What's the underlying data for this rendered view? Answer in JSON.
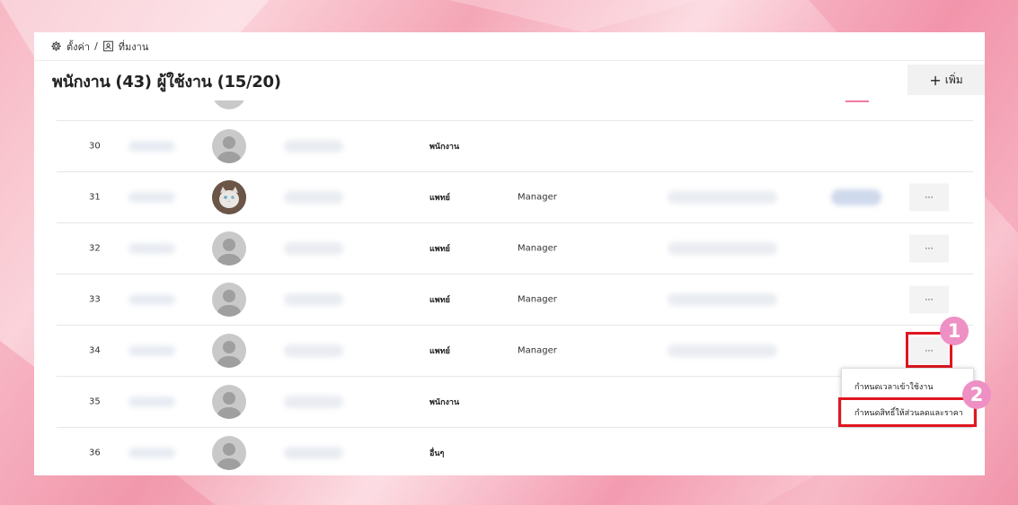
{
  "breadcrumb": {
    "settings_icon": "gear-icon",
    "settings_label": "ตั้งค่า",
    "separator": "/",
    "workspace_icon": "contact-card-icon",
    "workspace_label": "ที่มงาน"
  },
  "header": {
    "title": "พนักงาน (43) ผู้ใช้งาน (15/20)",
    "add_icon": "plus-icon",
    "add_label": "เพิ่ม"
  },
  "rows": [
    {
      "num": "30",
      "role": "พนักงาน",
      "position": ""
    },
    {
      "num": "31",
      "role": "แพทย์",
      "position": "Manager"
    },
    {
      "num": "32",
      "role": "แพทย์",
      "position": "Manager"
    },
    {
      "num": "33",
      "role": "แพทย์",
      "position": "Manager"
    },
    {
      "num": "34",
      "role": "แพทย์",
      "position": "Manager"
    },
    {
      "num": "35",
      "role": "พนักงาน",
      "position": ""
    },
    {
      "num": "36",
      "role": "อื่นๆ",
      "position": ""
    }
  ],
  "more_label": "...",
  "context_menu": {
    "item1": "กำหนดเวลาเข้าใช้งาน",
    "item2": "กำหนดสิทธิ์ให้ส่วนลดและราคา"
  },
  "annotations": {
    "badge1": "1",
    "badge2": "2"
  },
  "colors": {
    "highlight": "#e0161f",
    "badge": "#ee90c4",
    "page_bg": "#f7b8c4"
  }
}
